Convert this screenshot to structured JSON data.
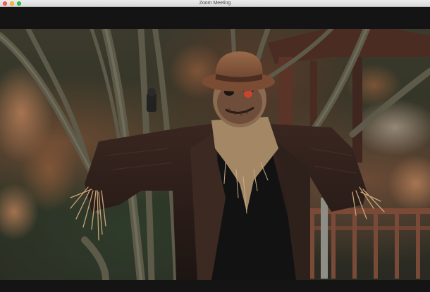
{
  "window": {
    "title": "Zoom Meeting"
  },
  "icons": {
    "close": "traffic-light-close",
    "minimize": "traffic-light-minimize",
    "maximize": "traffic-light-maximize"
  },
  "colors": {
    "close": "#fe5f57",
    "minimize": "#febc2e",
    "maximize": "#28c840",
    "background": "#141414"
  }
}
